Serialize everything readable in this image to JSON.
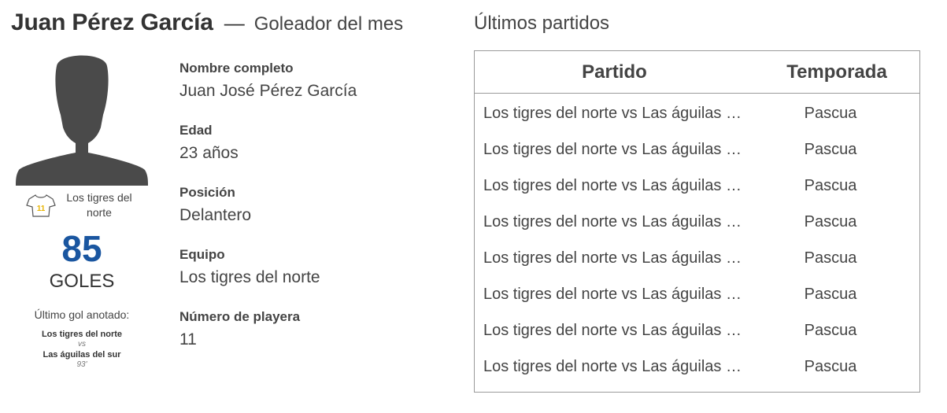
{
  "header": {
    "player_name": "Juan Pérez García",
    "separator": "—",
    "subtitle": "Goleador del mes"
  },
  "profile": {
    "avatar_icon": "person-silhouette-icon",
    "shirt_icon": "shirt-icon",
    "shirt_number": "11",
    "team": "Los tigres del norte",
    "goals": "85",
    "goals_label": "GOLES",
    "last_goal": {
      "title": "Último gol anotado:",
      "home": "Los tigres del norte",
      "vs": "vs",
      "away": "Las águilas del sur",
      "minute": "93'"
    }
  },
  "details": [
    {
      "label": "Nombre completo",
      "value": "Juan José Pérez García"
    },
    {
      "label": "Edad",
      "value": "23 años"
    },
    {
      "label": "Posición",
      "value": "Delantero"
    },
    {
      "label": "Equipo",
      "value": "Los tigres del norte"
    },
    {
      "label": "Número de playera",
      "value": "11"
    }
  ],
  "matches": {
    "title": "Últimos partidos",
    "columns": [
      "Partido",
      "Temporada"
    ],
    "rows": [
      {
        "match": "Los tigres del norte vs Las águilas del sur",
        "season": "Pascua"
      },
      {
        "match": "Los tigres del norte vs Las águilas del sur",
        "season": "Pascua"
      },
      {
        "match": "Los tigres del norte vs Las águilas del sur",
        "season": "Pascua"
      },
      {
        "match": "Los tigres del norte vs Las águilas del sur",
        "season": "Pascua"
      },
      {
        "match": "Los tigres del norte vs Las águilas del sur",
        "season": "Pascua"
      },
      {
        "match": "Los tigres del norte vs Las águilas del sur",
        "season": "Pascua"
      },
      {
        "match": "Los tigres del norte vs Las águilas del sur",
        "season": "Pascua"
      },
      {
        "match": "Los tigres del norte vs Las águilas del sur",
        "season": "Pascua"
      }
    ]
  },
  "colors": {
    "accent": "#1a56a0",
    "silhouette": "#4a4a4a",
    "shirt_number": "#e8b400",
    "border": "#9a9a9a"
  }
}
